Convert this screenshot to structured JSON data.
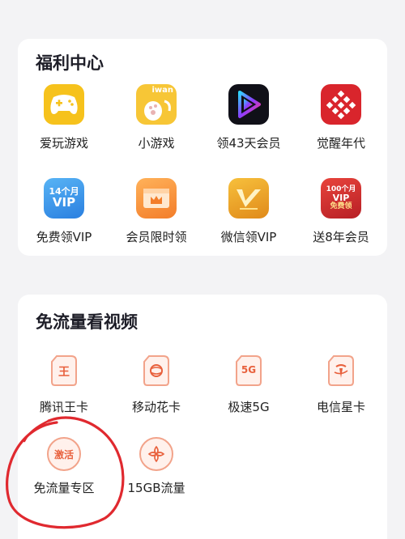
{
  "welfare": {
    "title": "福利中心",
    "items": [
      {
        "label": "爱玩游戏",
        "icon": "gamepad-icon"
      },
      {
        "label": "小游戏",
        "icon": "mini-game-cat-icon",
        "badge": "iwan"
      },
      {
        "label": "领43天会员",
        "icon": "video-play-icon"
      },
      {
        "label": "觉醒年代",
        "icon": "awakening-era-icon"
      },
      {
        "label": "免费领VIP",
        "icon": "vip-14-month-icon",
        "badge_top": "14个月",
        "badge_bottom": "VIP"
      },
      {
        "label": "会员限时领",
        "icon": "crown-card-icon"
      },
      {
        "label": "微信领VIP",
        "icon": "gold-v-icon"
      },
      {
        "label": "送8年会员",
        "icon": "vip-100-month-icon",
        "badge_top": "100个月",
        "badge_mid": "VIP",
        "badge_bottom": "免费领"
      }
    ]
  },
  "traffic": {
    "title": "免流量看视频",
    "items": [
      {
        "label": "腾讯王卡",
        "icon": "sim-king-icon",
        "glyph": "王"
      },
      {
        "label": "移动花卡",
        "icon": "sim-mobile-icon"
      },
      {
        "label": "极速5G",
        "icon": "sim-5g-icon",
        "glyph": "5G"
      },
      {
        "label": "电信星卡",
        "icon": "sim-telecom-icon"
      },
      {
        "label": "免流量专区",
        "icon": "activate-icon",
        "glyph": "激活"
      },
      {
        "label": "15GB流量",
        "icon": "unicom-icon"
      }
    ]
  },
  "colors": {
    "accent": "#e8603c",
    "annotation": "#e0292f",
    "game_yellow": "#f6c21c",
    "vip_blue": "#3a93ea",
    "vip_red": "#d43030"
  }
}
